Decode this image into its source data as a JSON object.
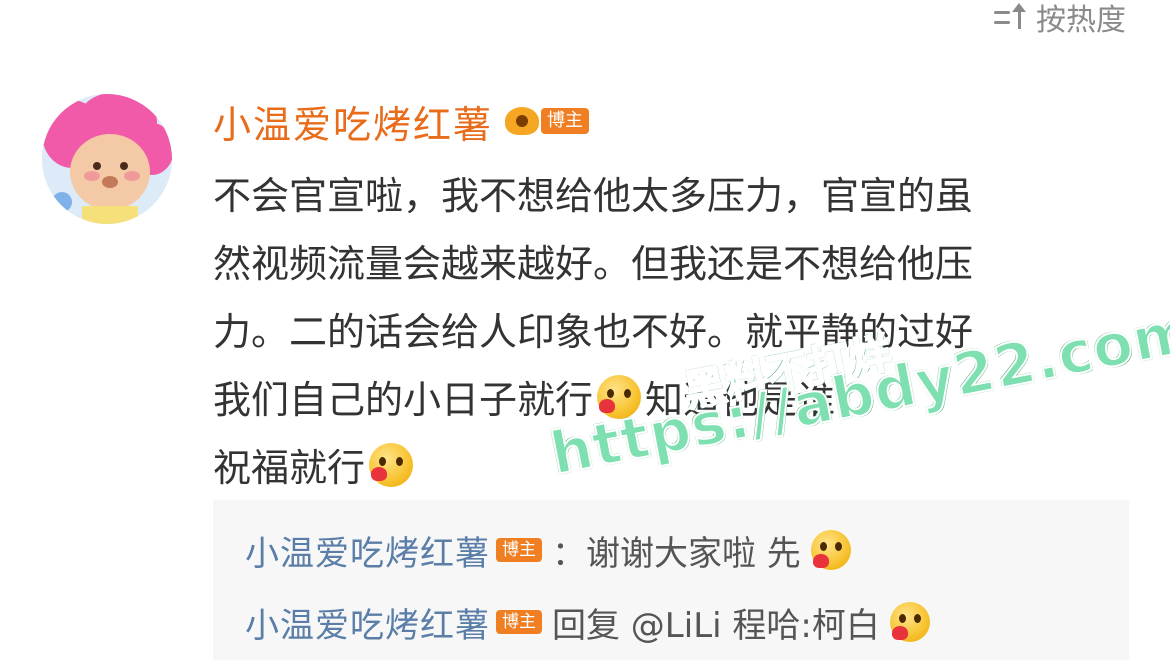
{
  "sort": {
    "label": "按热度",
    "icon": "sort-icon"
  },
  "post": {
    "username": "小温爱吃烤红薯",
    "badge": "博主",
    "comment_lines": [
      "不会官宣啦，我不想给他太多压力，官宣的虽",
      "然视频流量会越来越好。但我还是不想给他压",
      "力。二的话会给人印象也不好。就平静的过好",
      "我们自己的小日子就行",
      "知道他是谁，",
      "祝福就行"
    ]
  },
  "replies": [
    {
      "name": "小温爱吃烤红薯",
      "badge": "博主",
      "text": "：谢谢大家啦 先"
    },
    {
      "name": "小温爱吃烤红薯",
      "badge": "博主",
      "text": "回复 @LiLi 程哈:柯白"
    }
  ],
  "watermark": {
    "line1": "黑料不打烊",
    "line2": "https://abdy22.com"
  }
}
